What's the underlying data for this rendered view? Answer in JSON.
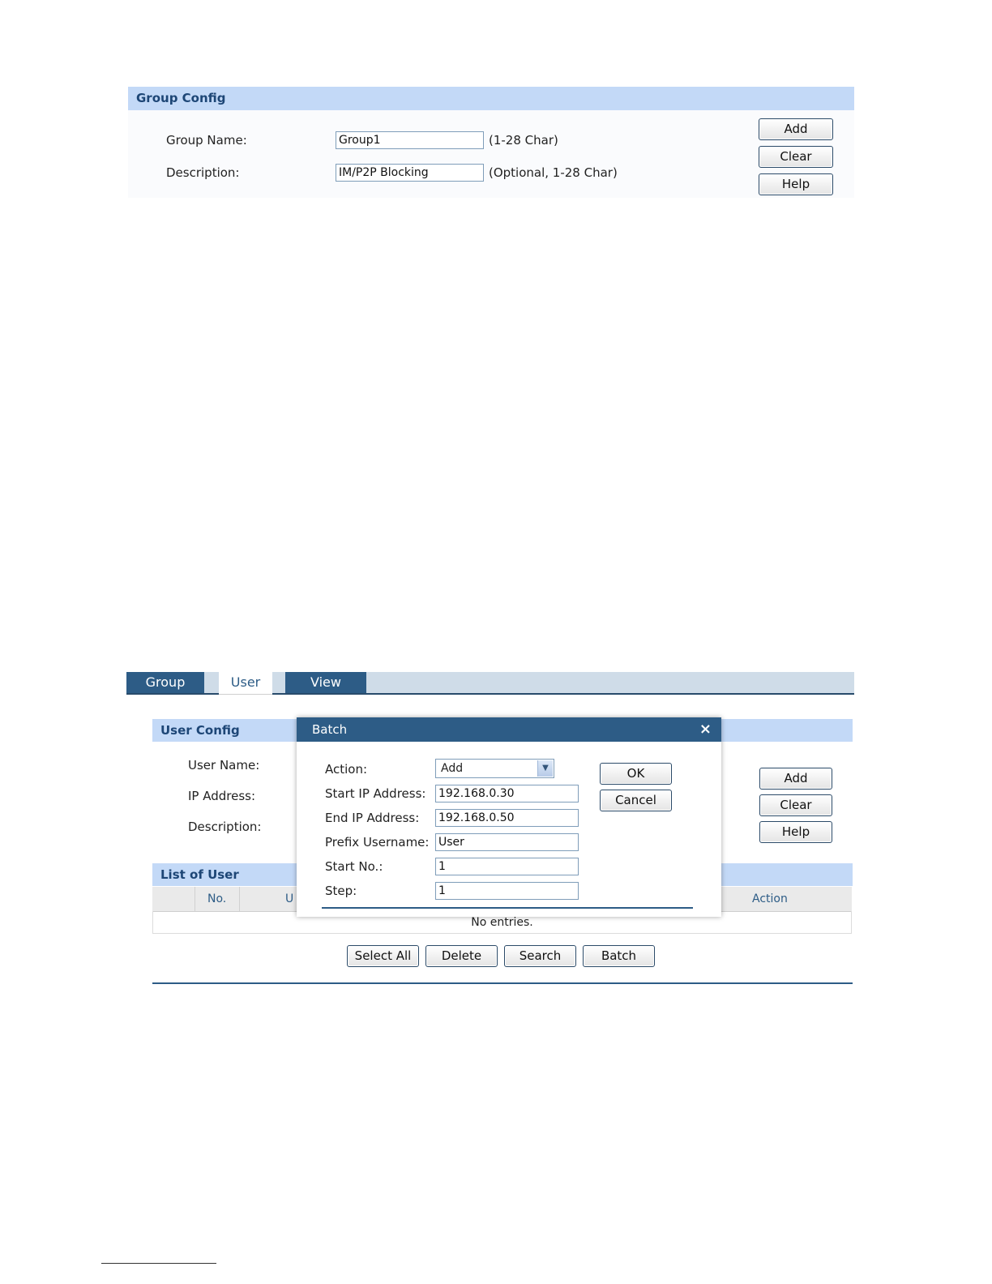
{
  "group_config": {
    "title": "Group Config",
    "group_name_label": "Group Name:",
    "group_name_value": "Group1",
    "group_name_hint": "(1-28 Char)",
    "description_label": "Description:",
    "description_value": "IM/P2P Blocking",
    "description_hint": "(Optional, 1-28 Char)",
    "add_label": "Add",
    "clear_label": "Clear",
    "help_label": "Help"
  },
  "tabs": [
    {
      "label": "Group"
    },
    {
      "label": "User"
    },
    {
      "label": "View"
    }
  ],
  "user_config": {
    "title": "User Config",
    "user_name_label": "User Name:",
    "ip_address_label": "IP Address:",
    "description_label": "Description:",
    "add_label": "Add",
    "clear_label": "Clear",
    "help_label": "Help"
  },
  "list_of_user": {
    "title": "List of User",
    "columns": {
      "no": "No.",
      "partial": "U",
      "action": "Action"
    },
    "empty_text": "No entries.",
    "select_all_label": "Select All",
    "delete_label": "Delete",
    "search_label": "Search",
    "batch_label": "Batch"
  },
  "batch_dialog": {
    "title": "Batch",
    "close_glyph": "×",
    "action_label": "Action:",
    "action_value": "Add",
    "start_ip_label": "Start IP Address:",
    "start_ip_value": "192.168.0.30",
    "end_ip_label": "End IP Address:",
    "end_ip_value": "192.168.0.50",
    "prefix_label": "Prefix Username:",
    "prefix_value": "User",
    "start_no_label": "Start No.:",
    "start_no_value": "1",
    "step_label": "Step:",
    "step_value": "1",
    "ok_label": "OK",
    "cancel_label": "Cancel"
  }
}
